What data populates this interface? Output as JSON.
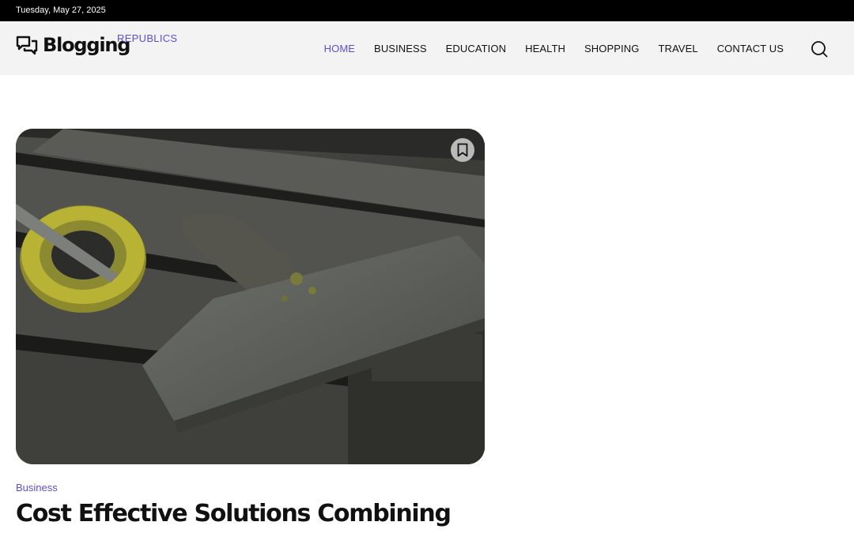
{
  "topbar": {
    "date": "Tuesday, May 27, 2025"
  },
  "brand": {
    "name": "Blogging",
    "tagline": "REPUBLICS",
    "icon": "chat-bubbles-icon",
    "accent_color": "#5b4fd6"
  },
  "nav": {
    "items": [
      {
        "label": "HOME",
        "active": true
      },
      {
        "label": "BUSINESS",
        "active": false
      },
      {
        "label": "EDUCATION",
        "active": false
      },
      {
        "label": "HEALTH",
        "active": false
      },
      {
        "label": "SHOPPING",
        "active": false
      },
      {
        "label": "TRAVEL",
        "active": false
      },
      {
        "label": "CONTACT US",
        "active": false
      }
    ],
    "search_icon": "search-icon"
  },
  "article": {
    "category": "Business",
    "title": "Cost Effective Solutions Combining",
    "bookmark_icon": "bookmark-icon"
  }
}
